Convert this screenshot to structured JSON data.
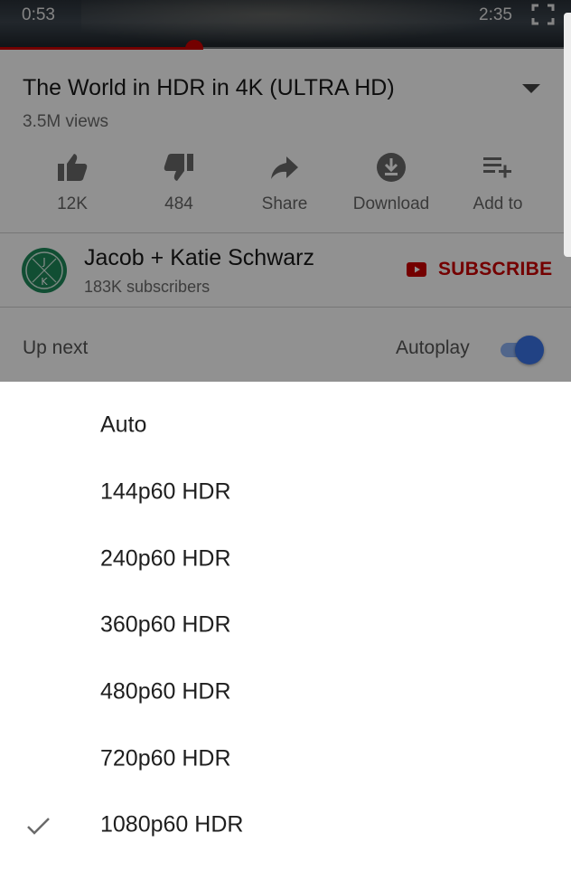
{
  "player": {
    "current_time": "0:53",
    "duration": "2:35",
    "progress": 0.34,
    "accent_color": "#cc0000"
  },
  "video": {
    "title": "The World in HDR in 4K (ULTRA HD)",
    "views": "3.5M views"
  },
  "actions": [
    {
      "icon": "thumbs-up-icon",
      "label": "12K"
    },
    {
      "icon": "thumbs-down-icon",
      "label": "484"
    },
    {
      "icon": "share-icon",
      "label": "Share"
    },
    {
      "icon": "download-icon",
      "label": "Download"
    },
    {
      "icon": "add-to-playlist-icon",
      "label": "Add to"
    }
  ],
  "channel": {
    "name": "Jacob + Katie Schwarz",
    "subscribers": "183K subscribers",
    "subscribe_label": "SUBSCRIBE",
    "avatar_letters": "JK"
  },
  "up_next": {
    "label": "Up next",
    "autoplay_label": "Autoplay",
    "autoplay_on": true
  },
  "quality_menu": {
    "options": [
      {
        "label": "Auto",
        "selected": false
      },
      {
        "label": "144p60 HDR",
        "selected": false
      },
      {
        "label": "240p60 HDR",
        "selected": false
      },
      {
        "label": "360p60 HDR",
        "selected": false
      },
      {
        "label": "480p60 HDR",
        "selected": false
      },
      {
        "label": "720p60 HDR",
        "selected": false
      },
      {
        "label": "1080p60 HDR",
        "selected": true
      }
    ]
  }
}
